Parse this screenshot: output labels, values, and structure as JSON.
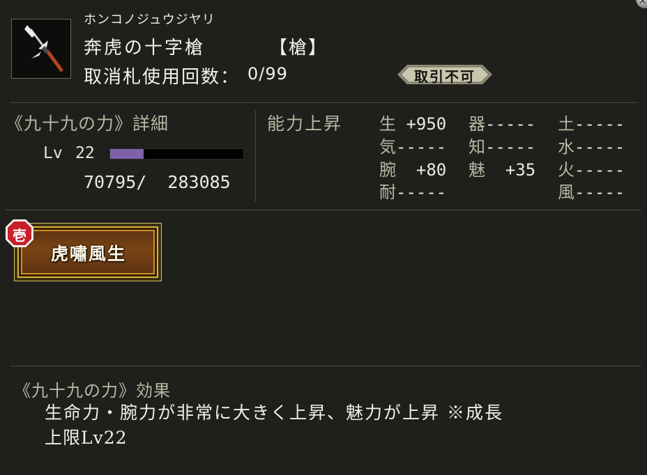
{
  "item": {
    "reading": "ホンコノジュウジヤリ",
    "name": "奔虎の十字槍",
    "type": "【槍】",
    "usage_label": "取消札使用回数：",
    "usage_value": "0/99",
    "trade_status": "取引不可",
    "icon": "spear-icon"
  },
  "detail": {
    "title": "《九十九の力》詳細",
    "lv_label": "Lv",
    "lv_value": "22",
    "xp_current": "70795",
    "xp_max": "283085",
    "xp_text": "70795/  283085",
    "xp_fraction": 0.25,
    "xp_bar_color": "#7e62a8"
  },
  "ability": {
    "title": "能力上昇",
    "stats": [
      {
        "name": "生",
        "value": " +950"
      },
      {
        "name": "器",
        "value": "-----"
      },
      {
        "name": "土",
        "value": "-----"
      },
      {
        "name": "気",
        "value": "-----"
      },
      {
        "name": "知",
        "value": "-----"
      },
      {
        "name": "水",
        "value": "-----"
      },
      {
        "name": "腕",
        "value": "  +80"
      },
      {
        "name": "魅",
        "value": "  +35"
      },
      {
        "name": "火",
        "value": "-----"
      },
      {
        "name": "耐",
        "value": "-----"
      },
      {
        "name": "風",
        "value": "-----"
      }
    ]
  },
  "skill": {
    "badge": "壱",
    "name": "虎嘯風生"
  },
  "effect": {
    "title": "《九十九の力》効果",
    "line1": "生命力・腕力が非常に大きく上昇、魅力が上昇 ※成長",
    "line2": "上限Lv22"
  },
  "colors": {
    "background": "#1f1f1b",
    "label": "#b8b7a4",
    "text": "#f2efe6",
    "accent_gold": "#d9b23a",
    "badge_red": "#c8202a"
  }
}
